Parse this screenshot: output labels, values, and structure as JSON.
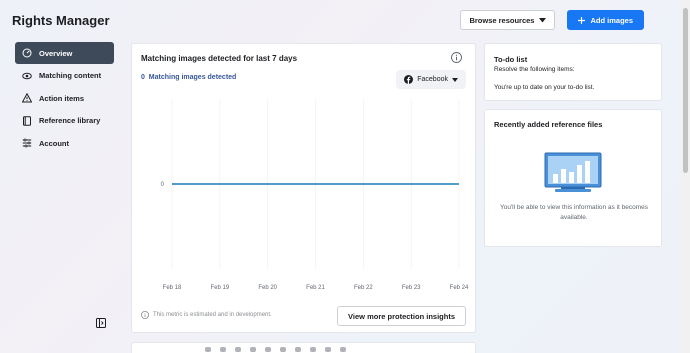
{
  "app": {
    "title": "Rights Manager"
  },
  "header": {
    "browse_label": "Browse resources",
    "add_label": "Add images"
  },
  "nav": {
    "items": [
      {
        "label": "Overview",
        "icon": "speedometer-icon"
      },
      {
        "label": "Matching content",
        "icon": "eye-icon"
      },
      {
        "label": "Action items",
        "icon": "warning-icon"
      },
      {
        "label": "Reference library",
        "icon": "book-icon"
      },
      {
        "label": "Account",
        "icon": "settings-list-icon"
      }
    ]
  },
  "main": {
    "title": "Matching images detected for last 7 days",
    "count_value": "0",
    "count_label": "Matching images detected",
    "platform": "Facebook",
    "footnote": "This metric is estimated and in development.",
    "insights_label": "View more protection insights"
  },
  "chart_data": {
    "type": "line",
    "x": [
      "Feb 18",
      "Feb 19",
      "Feb 20",
      "Feb 21",
      "Feb 22",
      "Feb 23",
      "Feb 24"
    ],
    "series": [
      {
        "values": [
          0,
          0,
          0,
          0,
          0,
          0,
          0
        ]
      }
    ],
    "yticks": [
      "0"
    ],
    "grid": true,
    "line_color": "#1c7ab8"
  },
  "todo": {
    "title": "To-do list",
    "subtitle": "Resolve the following items:",
    "status": "You're up to date on your to-do list."
  },
  "reference": {
    "title": "Recently added reference files",
    "message": "You'll be able to view this information as it becomes available."
  },
  "colors": {
    "accent": "#1877f2",
    "nav_active": "#3e4a59",
    "link": "#385898"
  }
}
